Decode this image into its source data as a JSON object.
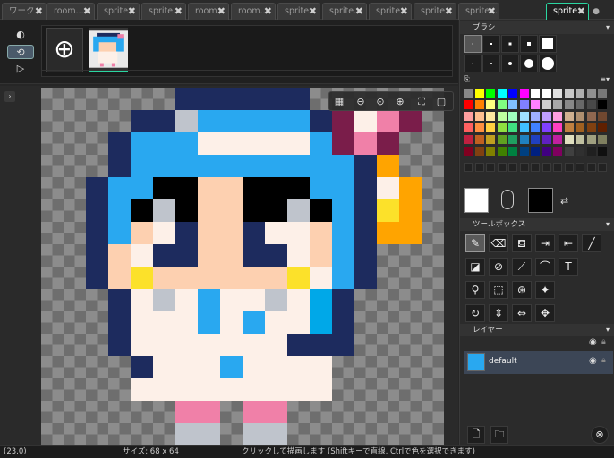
{
  "tabs": [
    {
      "label": "ワーク..."
    },
    {
      "label": "room..."
    },
    {
      "label": "sprite..."
    },
    {
      "label": "sprite..."
    },
    {
      "label": "room..."
    },
    {
      "label": "room..."
    },
    {
      "label": "sprite..."
    },
    {
      "label": "sprite..."
    },
    {
      "label": "sprite..."
    },
    {
      "label": "sprite..."
    },
    {
      "label": "sprite..."
    },
    {
      "label": "sprite..."
    }
  ],
  "tab_close_glyph": "✖",
  "canvas": {
    "zoom_icons": [
      "grid-icon",
      "zoom-out-icon",
      "zoom-reset-icon",
      "zoom-in-icon",
      "fit-icon",
      "frame-icon"
    ]
  },
  "right_panel": {
    "brush_title": "ブラシ",
    "toolbox_title": "ツールボックス",
    "layers_title": "レイヤー",
    "layer_name": "default",
    "primary_color": "#ffffff",
    "secondary_color": "#000000"
  },
  "status": {
    "coords": "(23,0)",
    "size": "サイズ: 68 x 64",
    "hint": "クリックして描画します (Shiftキーで直線, Ctrlで色を選択できます)"
  },
  "palette": [
    "#888888",
    "#ffff00",
    "#00ff00",
    "#00ffff",
    "#0000ff",
    "#ff00ff",
    "#ffffff",
    "#ffffff",
    "#e0e0e0",
    "#c8c8c8",
    "#b0b0b0",
    "#909090",
    "#787878",
    "#ff0000",
    "#ff8000",
    "#ffff80",
    "#80ff80",
    "#80c0ff",
    "#8080ff",
    "#ff80ff",
    "#d0d0d0",
    "#a8a8a8",
    "#888888",
    "#686868",
    "#484848",
    "#000000",
    "#ffa0a0",
    "#ffc090",
    "#ffe8a0",
    "#c0ffa0",
    "#a0ffc0",
    "#a0e0ff",
    "#a0b0ff",
    "#c0a0ff",
    "#ffa0e0",
    "#d0b090",
    "#b09070",
    "#906850",
    "#704830",
    "#ff6060",
    "#ff9040",
    "#ffd040",
    "#90e040",
    "#40e080",
    "#40c0ff",
    "#4080ff",
    "#8040ff",
    "#ff40c0",
    "#c08040",
    "#a06020",
    "#804010",
    "#602000",
    "#c02040",
    "#c06020",
    "#c0a020",
    "#60a020",
    "#20a060",
    "#2080c0",
    "#2040c0",
    "#6020c0",
    "#c020a0",
    "#e0e0c0",
    "#c0c0a0",
    "#a0a080",
    "#808060",
    "#800020",
    "#804010",
    "#808000",
    "#408000",
    "#008040",
    "#004080",
    "#002080",
    "#400080",
    "#800060",
    "#404040",
    "#303030",
    "#202020",
    "#101010"
  ]
}
